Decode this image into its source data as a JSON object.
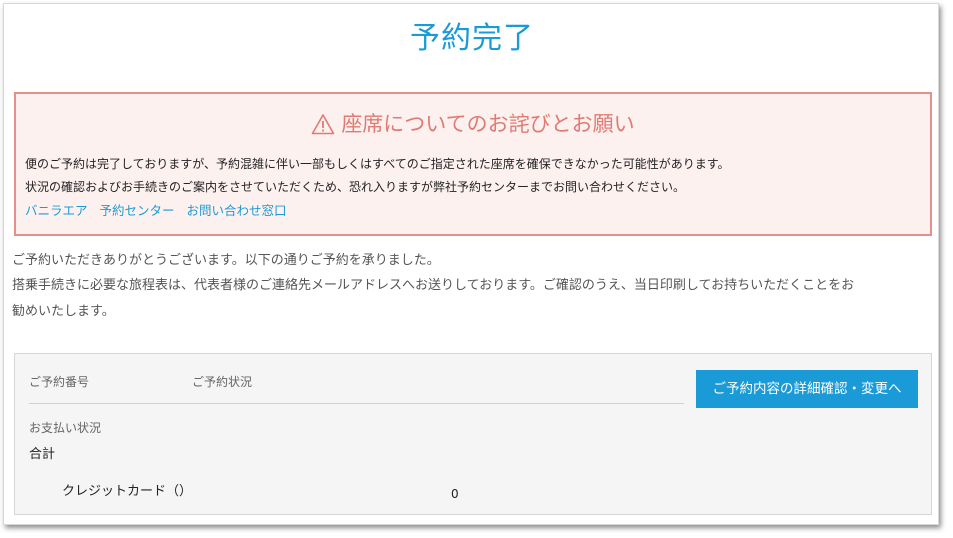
{
  "page": {
    "title": "予約完了"
  },
  "notice": {
    "title": "座席についてのお詫びとお願い",
    "icon": "warning-triangle-icon",
    "line1": "便のご予約は完了しておりますが、予約混雑に伴い一部もしくはすべてのご指定された座席を確保できなかった可能性があります。",
    "line2": "状況の確認およびお手続きのご案内をさせていただくため、恐れ入りますが弊社予約センターまでお問い合わせください。",
    "links": [
      "バニラエア",
      "予約センター",
      "お問い合わせ窓口"
    ]
  },
  "message": {
    "line1": "ご予約いただきありがとうございます。以下の通りご予約を承りました。",
    "line2": "搭乗手続きに必要な旅程表は、代表者様のご連絡先メールアドレスへお送りしております。ご確認のうえ、当日印刷してお持ちいただくことをお",
    "line3": "勧めいたします。"
  },
  "booking": {
    "number_label": "ご予約番号",
    "status_label": "ご予約状況",
    "detail_button": "ご予約内容の詳細確認・変更へ",
    "payment_label": "お支払い状況",
    "total_label": "合計",
    "card_label": "クレジットカード（）",
    "card_amount": "0"
  },
  "colors": {
    "accent": "#1a9ad6",
    "notice_border": "#e5908a",
    "notice_bg": "#fdf1f0",
    "notice_title": "#e07a72"
  }
}
